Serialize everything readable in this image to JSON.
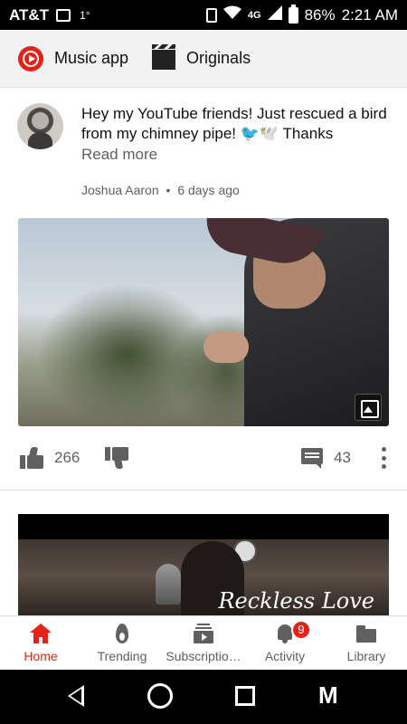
{
  "status_bar": {
    "carrier": "AT&T",
    "temp": "1°",
    "network": "4G",
    "battery": "86%",
    "time": "2:21 AM"
  },
  "chips": [
    {
      "label": "Music app",
      "icon": "music-app-icon"
    },
    {
      "label": "Originals",
      "icon": "clapperboard-icon"
    }
  ],
  "post": {
    "text": "Hey my YouTube friends! Just rescued a bird from my chimney pipe! 🐦🕊️ Thanks",
    "read_more": "Read more",
    "author": "Joshua Aaron",
    "separator": "•",
    "age": "6 days ago",
    "likes": "266",
    "comments": "43"
  },
  "video2": {
    "overlay_title": "Reckless Love"
  },
  "bottom_nav": {
    "items": [
      {
        "label": "Home",
        "active": true
      },
      {
        "label": "Trending",
        "active": false
      },
      {
        "label": "Subscriptio…",
        "active": false
      },
      {
        "label": "Activity",
        "active": false
      },
      {
        "label": "Library",
        "active": false
      }
    ],
    "activity_badge": "9"
  },
  "colors": {
    "accent": "#e62117",
    "text_secondary": "#606060"
  }
}
